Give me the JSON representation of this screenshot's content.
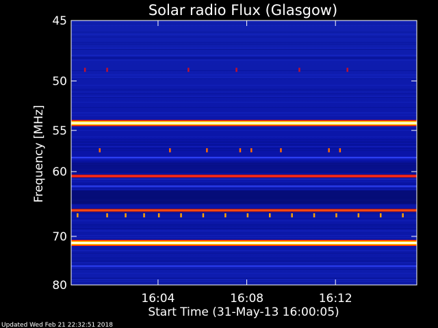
{
  "chart_data": {
    "type": "heatmap",
    "title": "Solar radio Flux (Glasgow)",
    "ylabel": "Frequency [MHz]",
    "xlabel": "Start Time (31-May-13 16:00:05)",
    "ylim": [
      45,
      80
    ],
    "y_axis_inverted": true,
    "y_scale": "reciprocal",
    "xlim": [
      "16:00:05",
      "16:15:40"
    ],
    "y_ticks": [
      {
        "value": 45,
        "label": "45"
      },
      {
        "value": 50,
        "label": "50"
      },
      {
        "value": 55,
        "label": "55"
      },
      {
        "value": 60,
        "label": "60"
      },
      {
        "value": 70,
        "label": "70"
      },
      {
        "value": 80,
        "label": "80"
      }
    ],
    "x_ticks": [
      {
        "value": "16:04",
        "label": "16:04"
      },
      {
        "value": "16:08",
        "label": "16:08"
      },
      {
        "value": "16:12",
        "label": "16:12"
      }
    ],
    "colormap": [
      "#000064",
      "#0000b4",
      "#1e28dc",
      "#ff2000",
      "#ffc000",
      "#ffffff"
    ],
    "background_color": "#0a14a8",
    "bands": [
      {
        "freq": 54.2,
        "level": "max",
        "color": "#ffffdc"
      },
      {
        "freq": 60.6,
        "level": "high",
        "color": "#ff2814"
      },
      {
        "freq": 65.6,
        "level": "high",
        "color": "#ff4a10"
      },
      {
        "freq": 71.2,
        "level": "max",
        "color": "#ffffdc"
      },
      {
        "freq": 58.2,
        "level": "medium",
        "color": "#3246ff"
      },
      {
        "freq": 62.0,
        "level": "medium",
        "color": "#2c40f0"
      },
      {
        "freq": 75.8,
        "level": "medium",
        "color": "#2c3ef0"
      }
    ],
    "bursts": [
      {
        "freq": 57.3,
        "times": [
          "16:01:20",
          "16:04:30",
          "16:06:10",
          "16:07:40",
          "16:08:10",
          "16:09:30",
          "16:11:40",
          "16:12:10"
        ],
        "color": "#ff6a00"
      },
      {
        "freq": 66.4,
        "times": [
          "16:00:20",
          "16:01:40",
          "16:02:30",
          "16:03:20",
          "16:04:00",
          "16:05:00",
          "16:06:00",
          "16:07:00",
          "16:08:00",
          "16:09:00",
          "16:10:00",
          "16:11:00",
          "16:12:00",
          "16:13:00",
          "16:14:00",
          "16:15:00"
        ],
        "color": "#ffa000"
      },
      {
        "freq": 49.0,
        "times": [
          "16:00:40",
          "16:01:40",
          "16:05:20",
          "16:07:30",
          "16:10:20",
          "16:12:30"
        ],
        "color": "#c01030"
      }
    ]
  },
  "footer": {
    "updated": "Updated Wed Feb 21 22:32:51 2018"
  }
}
